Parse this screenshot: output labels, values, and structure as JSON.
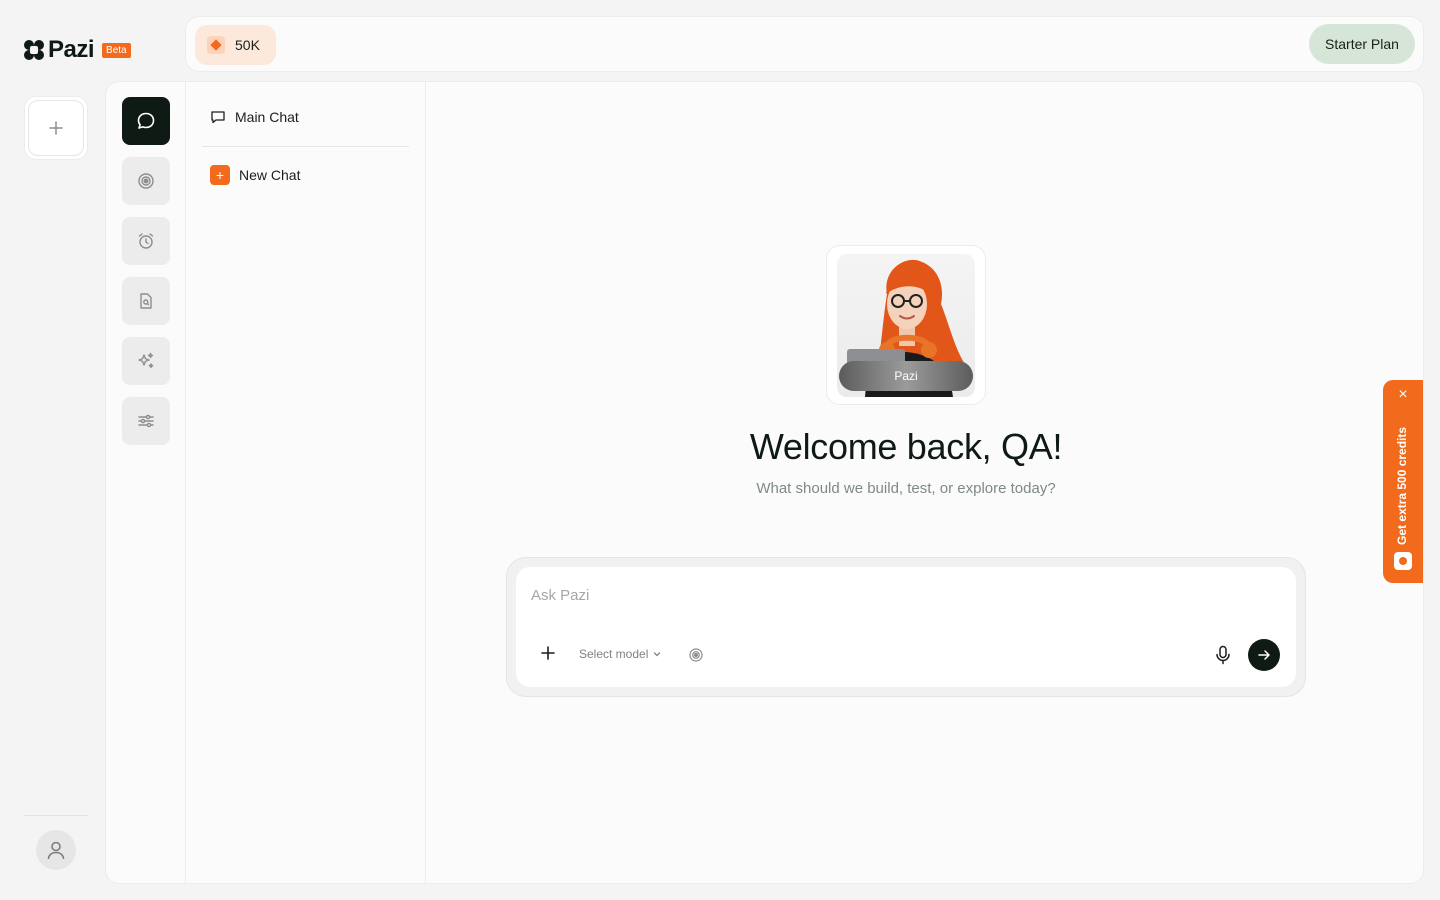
{
  "brand": {
    "name": "Pazi",
    "badge": "Beta"
  },
  "topbar": {
    "credits": "50K",
    "plan": "Starter Plan"
  },
  "chats": {
    "main": "Main Chat",
    "new": "New Chat"
  },
  "nav": {
    "items": [
      {
        "name": "chat",
        "icon": "chat-bubble-icon",
        "active": true
      },
      {
        "name": "target",
        "icon": "target-icon",
        "active": false
      },
      {
        "name": "alarm",
        "icon": "alarm-clock-icon",
        "active": false
      },
      {
        "name": "file-search",
        "icon": "file-search-icon",
        "active": false
      },
      {
        "name": "sparkles",
        "icon": "sparkles-icon",
        "active": false
      },
      {
        "name": "settings",
        "icon": "sliders-icon",
        "active": false
      }
    ]
  },
  "assistant": {
    "name": "Pazi"
  },
  "welcome": {
    "title": "Welcome back, QA!",
    "subtitle": "What should we build, test, or explore today?"
  },
  "composer": {
    "placeholder": "Ask Pazi",
    "model_select": "Select model"
  },
  "promo": {
    "text": "Get extra 500 credits"
  },
  "colors": {
    "accent": "#f26a1b",
    "dark": "#0f1a14",
    "plan_bg": "#d5e6d8",
    "credits_bg": "#fde8dc"
  }
}
